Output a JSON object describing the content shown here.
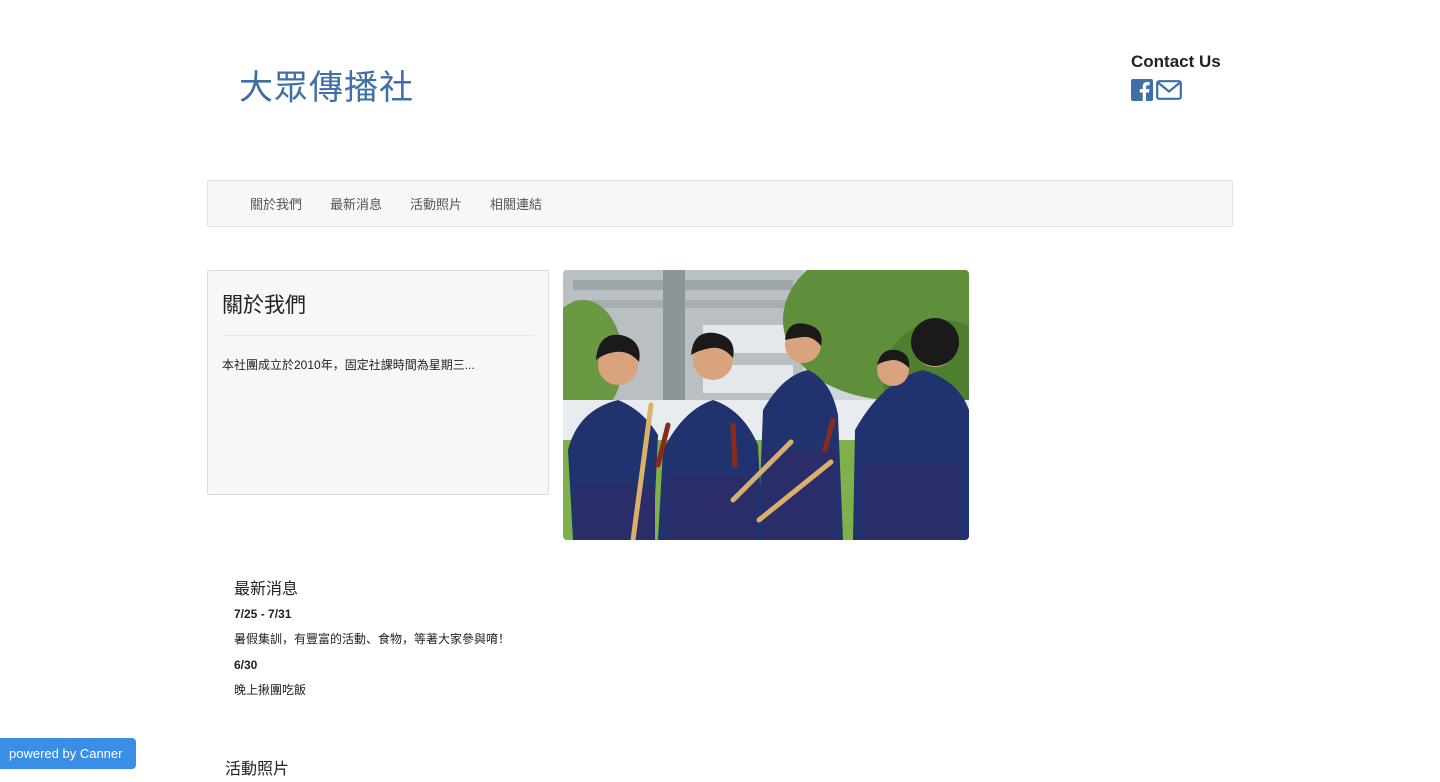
{
  "site": {
    "title": "大眾傳播社"
  },
  "contact": {
    "label": "Contact Us",
    "icons": [
      "facebook-icon",
      "mail-icon"
    ],
    "accent": "#3f6fa8"
  },
  "nav": {
    "items": [
      "關於我們",
      "最新消息",
      "活動照片",
      "相關連結"
    ]
  },
  "about": {
    "title": "關於我們",
    "body": "本社團成立於2010年，固定社課時間為星期三..."
  },
  "news": {
    "title": "最新消息",
    "items": [
      {
        "date": "7/25 - 7/31",
        "text": "暑假集訓，有豐富的活動、食物，等著大家參與唷！"
      },
      {
        "date": "6/30",
        "text": "晚上揪團吃飯"
      }
    ]
  },
  "photos": {
    "title": "活動照片"
  },
  "badge": {
    "label": "powered by Canner",
    "color": "#3a8ee6"
  }
}
